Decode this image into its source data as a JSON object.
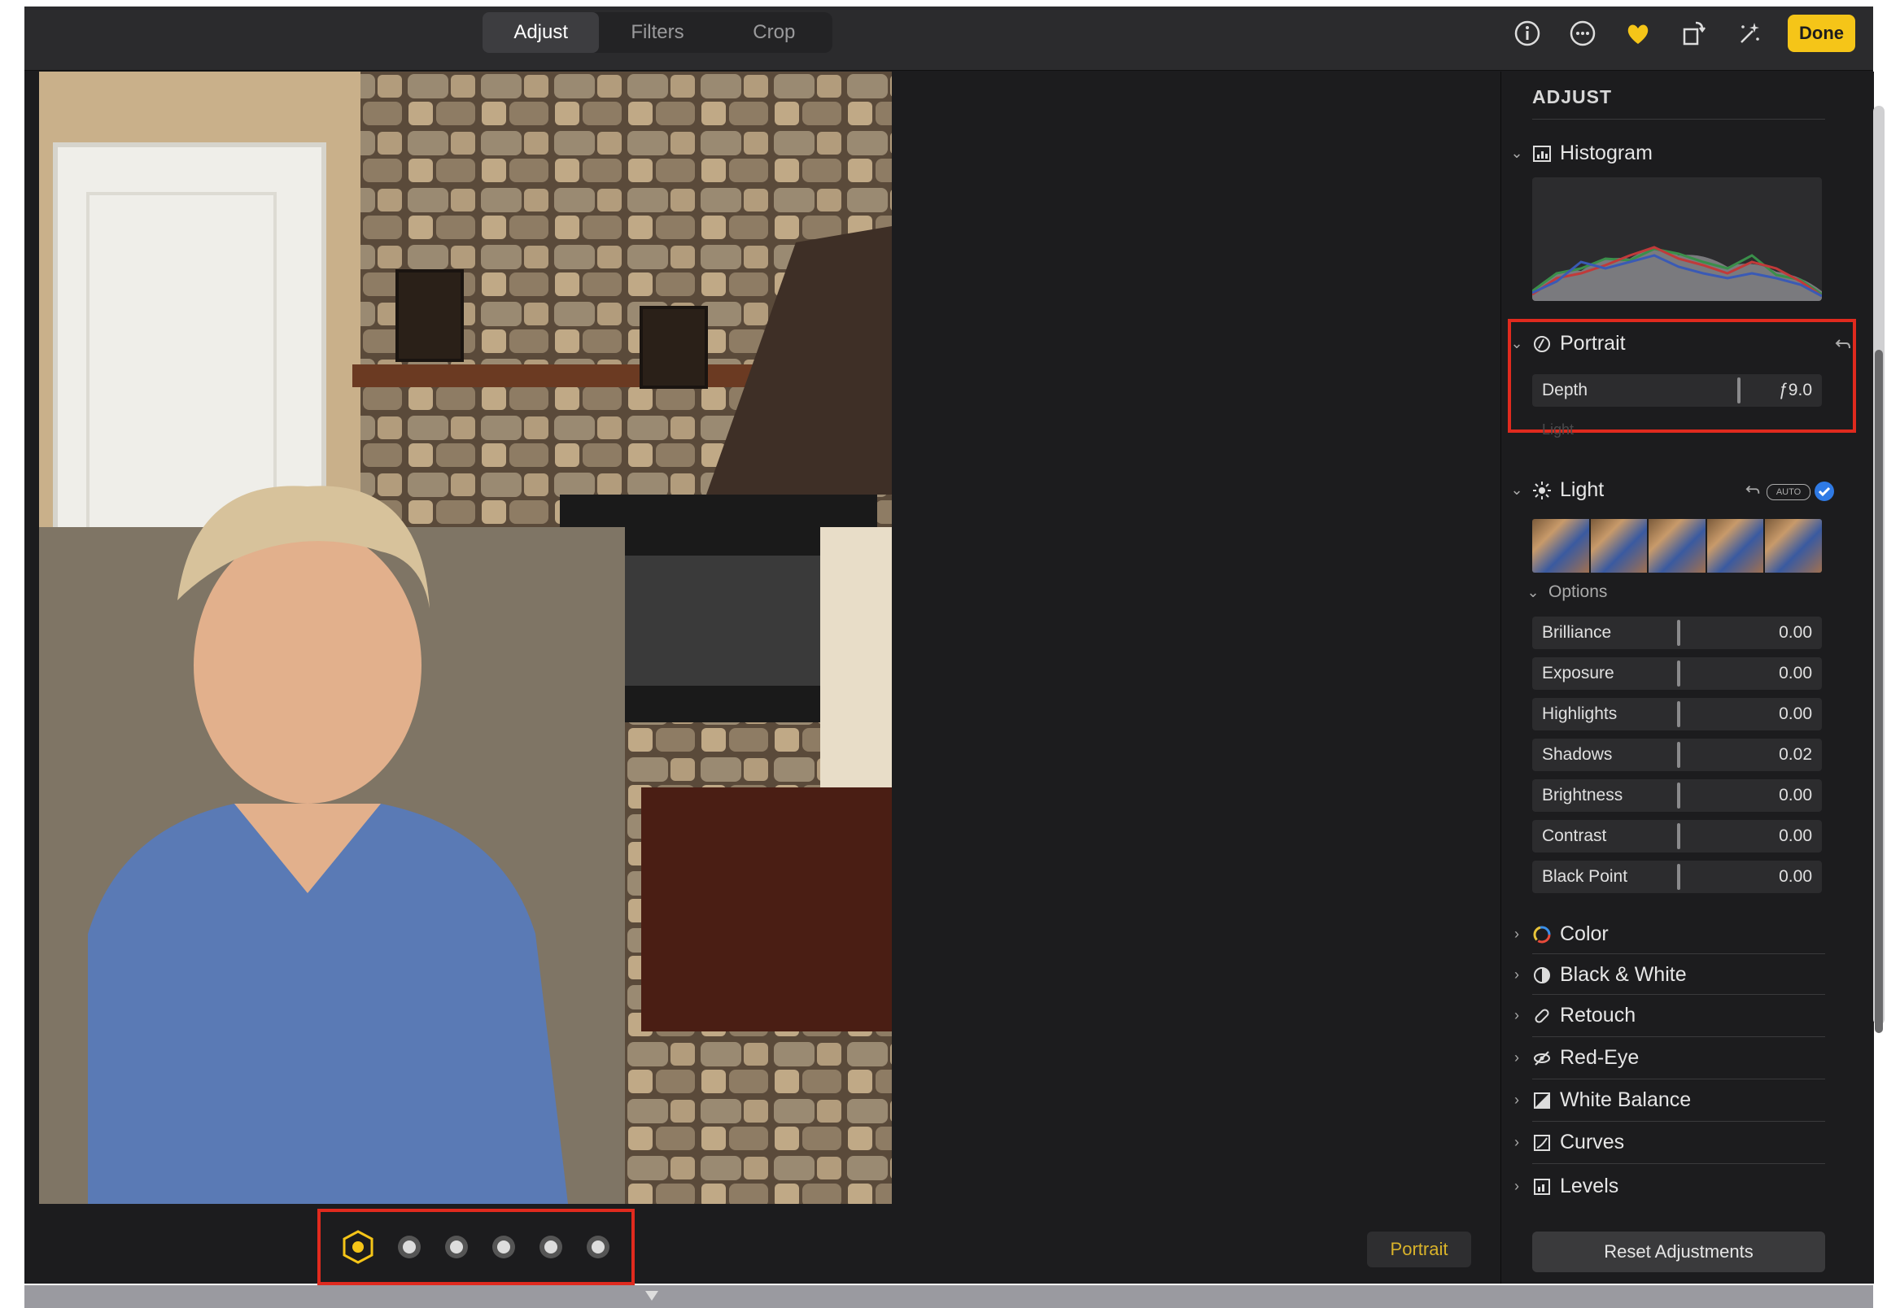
{
  "toolbar": {
    "tabs": [
      "Adjust",
      "Filters",
      "Crop"
    ],
    "active_tab": "Adjust",
    "icons": [
      "info-icon",
      "more-icon",
      "heart-icon",
      "rotate-icon",
      "magic-wand-icon"
    ],
    "done_label": "Done",
    "accent_color": "#f5c518"
  },
  "photo_controls": {
    "lighting_effects": [
      "studio-light-cube-icon",
      "light-dot-icon",
      "light-dot-icon",
      "light-dot-icon",
      "light-dot-icon",
      "light-dot-icon"
    ],
    "portrait_button": "Portrait"
  },
  "sidebar": {
    "title": "ADJUST",
    "histogram": {
      "label": "Histogram"
    },
    "portrait": {
      "label": "Portrait",
      "depth_label": "Depth",
      "depth_value": "ƒ9.0",
      "light_label": "Light"
    },
    "light": {
      "label": "Light",
      "auto_label": "AUTO",
      "options_label": "Options",
      "sliders": [
        {
          "label": "Brilliance",
          "value": "0.00"
        },
        {
          "label": "Exposure",
          "value": "0.00"
        },
        {
          "label": "Highlights",
          "value": "0.00"
        },
        {
          "label": "Shadows",
          "value": "0.02"
        },
        {
          "label": "Brightness",
          "value": "0.00"
        },
        {
          "label": "Contrast",
          "value": "0.00"
        },
        {
          "label": "Black Point",
          "value": "0.00"
        }
      ]
    },
    "collapsed_sections": [
      "Color",
      "Black & White",
      "Retouch",
      "Red-Eye",
      "White Balance",
      "Curves",
      "Levels"
    ],
    "reset_label": "Reset Adjustments"
  }
}
